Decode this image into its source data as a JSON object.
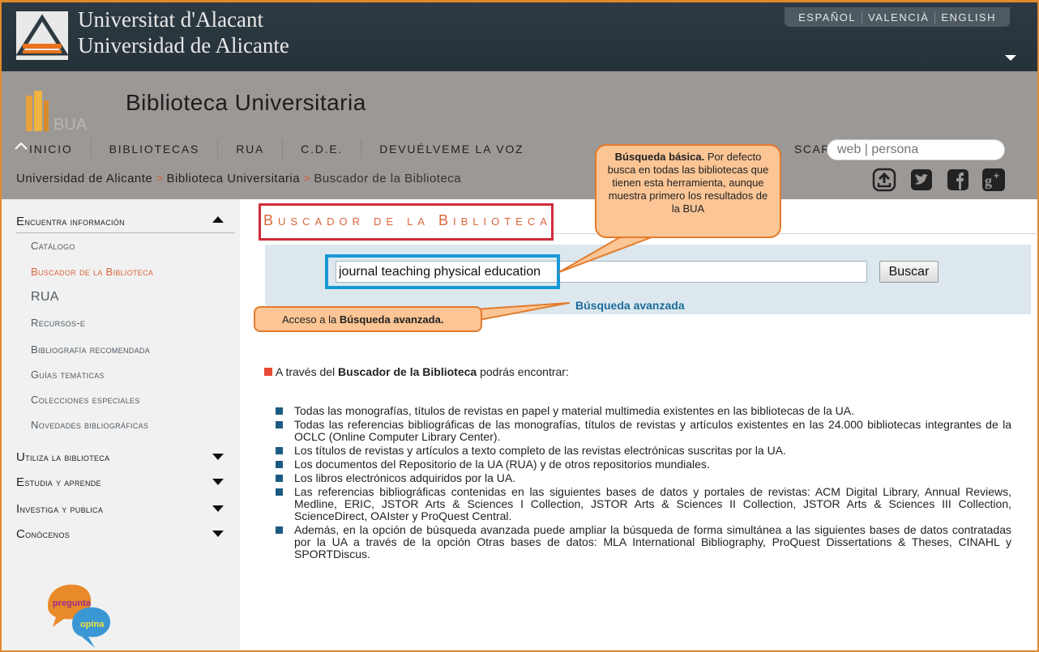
{
  "header": {
    "university_line1": "Universitat d'Alacant",
    "university_line2": "Universidad de Alicante",
    "languages": [
      "ESPAÑOL",
      "VALENCIÀ",
      "ENGLISH"
    ]
  },
  "library": {
    "logo_text": "BUA",
    "title": "Biblioteca Universitaria"
  },
  "nav": {
    "items": [
      "INICIO",
      "BIBLIOTECAS",
      "RUA",
      "C.D.E.",
      "DEVUÉLVEME LA VOZ"
    ],
    "search_label": "SCAR",
    "search_placeholder": "web | persona"
  },
  "breadcrumb": {
    "items": [
      "Universidad de Alicante",
      "Biblioteca Universitaria",
      "Buscador de la Biblioteca"
    ],
    "separator": ">"
  },
  "social_icons": [
    "upload-icon",
    "twitter-icon",
    "facebook-icon",
    "googleplus-icon"
  ],
  "sidebar": {
    "sections": [
      {
        "label": "Encuentra información",
        "expanded": true
      },
      {
        "label": "Utiliza la biblioteca",
        "expanded": false
      },
      {
        "label": "Estudia y aprende",
        "expanded": false
      },
      {
        "label": "Investiga y publica",
        "expanded": false
      },
      {
        "label": "Conócenos",
        "expanded": false
      }
    ],
    "items": [
      "Catálogo",
      "Buscador de la Biblioteca",
      "RUA",
      "Recursos-e",
      "Bibliografía recomendada",
      "Guías temáticas",
      "Colecciones especiales",
      "Novedades bibliográficas"
    ],
    "active_item": "Buscador de la Biblioteca",
    "badge_top": "pregunta",
    "badge_bottom": "opina"
  },
  "main": {
    "title": "Buscador de la Biblioteca",
    "query_value": "journal teaching physical education",
    "search_button": "Buscar",
    "advanced_link": "Búsqueda avanzada",
    "callout_top_bold": "Búsqueda básica.",
    "callout_top_text": " Por defecto busca en todas las bibliotecas que tienen esta herramienta, aunque muestra primero los resultados de la BUA",
    "callout_bottom_text": "Acceso a la ",
    "callout_bottom_bold": "Búsqueda avanzada.",
    "intro_pre": "A través del ",
    "intro_bold": "Buscador de la Biblioteca",
    "intro_post": " podrás encontrar:",
    "bullets": [
      "Todas las monografías, títulos de revistas en papel y material multimedia existentes en las bibliotecas de la UA.",
      "Todas las referencias bibliográficas de las monografías, títulos de revistas y artículos existentes en las 24.000 bibliotecas integrantes de la OCLC (Online Computer Library Center).",
      "Los títulos de revistas y artículos a texto completo de las revistas electrónicas suscritas por la UA.",
      "Los documentos del Repositorio de la UA (RUA) y de otros repositorios mundiales.",
      "Los libros electrónicos  adquiridos por la UA.",
      "Las referencias bibliográficas contenidas en las siguientes bases de datos y portales de revistas: ACM Digital Library, Annual Reviews, Medline, ERIC, JSTOR Arts & Sciences I Collection, JSTOR Arts & Sciences II Collection, JSTOR Arts & Sciences III Collection, ScienceDirect, OAIster y  ProQuest Central.",
      "Además, en la opción de búsqueda avanzada  puede ampliar la búsqueda de forma simultánea a las siguientes bases de datos contratadas por la UA a través de la opción Otras bases de datos: MLA International Bibliography, ProQuest Dissertations & Theses, CINAHL y SPORTDiscus."
    ]
  },
  "colors": {
    "header_dark": "#263239",
    "band_grey": "#9c9896",
    "accent_orange": "#d9663a",
    "title_box_red": "#d12c38",
    "highlight_blue": "#1898d6",
    "callout_fill": "#fbc595",
    "bullet_blue": "#1b5b82"
  }
}
